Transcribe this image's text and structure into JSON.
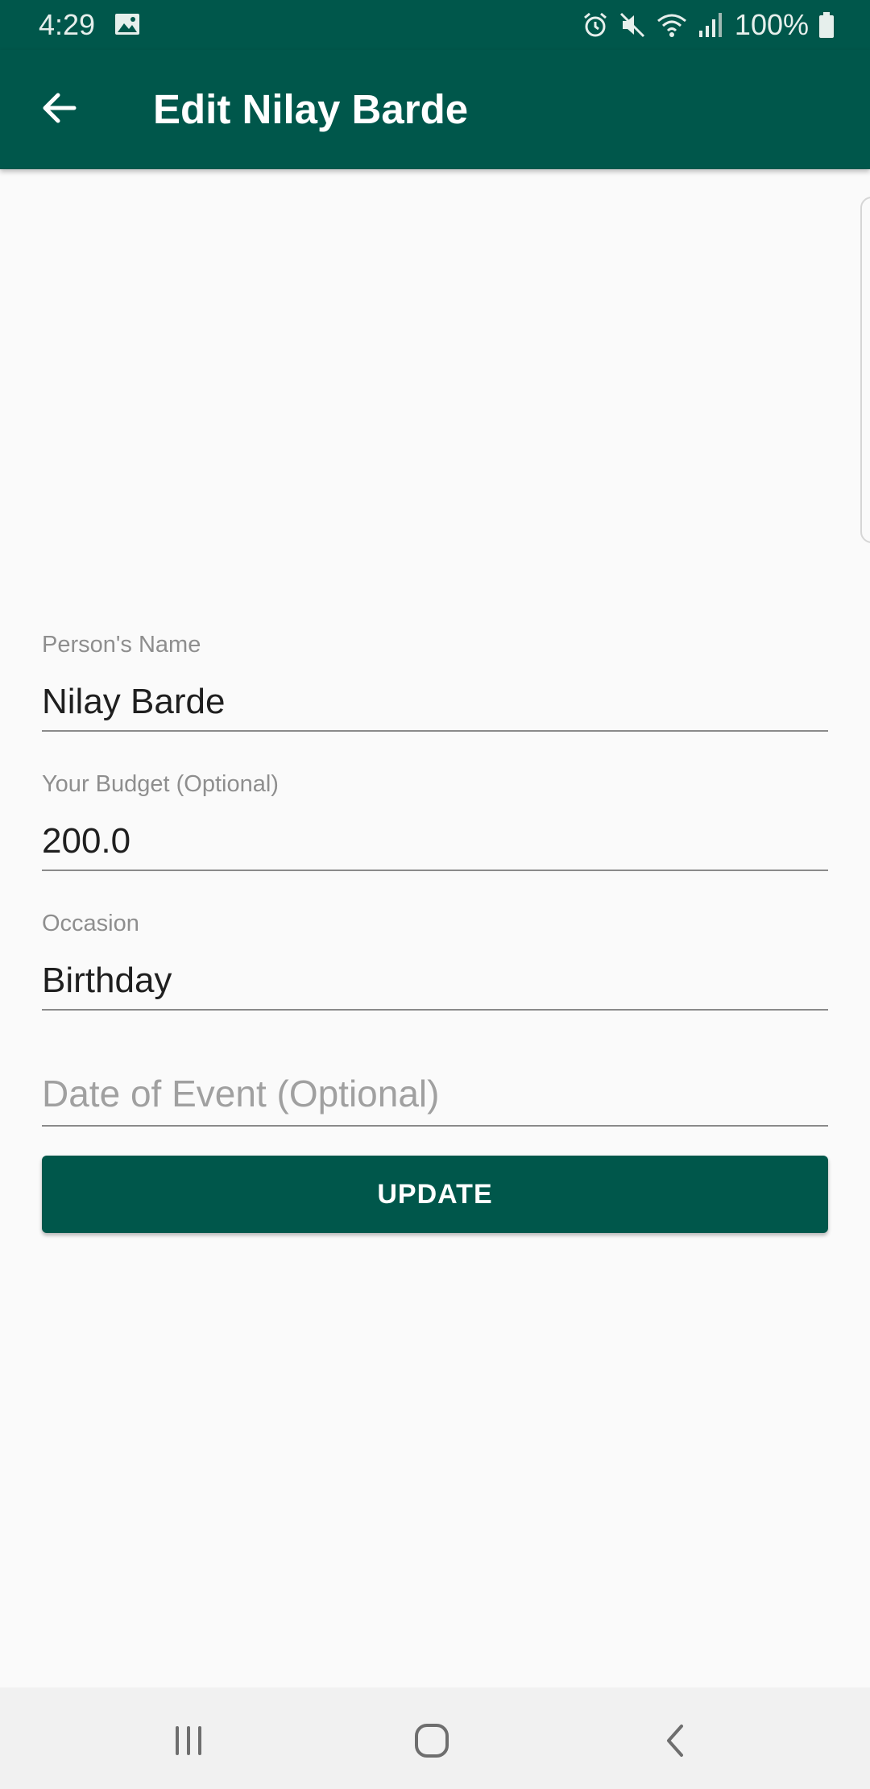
{
  "status_bar": {
    "time": "4:29",
    "battery": "100%",
    "icons": [
      "gallery-icon",
      "alarm-icon",
      "mute-icon",
      "wifi-icon",
      "signal-icon",
      "battery-icon"
    ]
  },
  "app_bar": {
    "title": "Edit Nilay Barde",
    "back_icon": "arrow-left-icon",
    "background_color": "#00574b"
  },
  "form": {
    "name": {
      "label": "Person's Name",
      "value": "Nilay Barde"
    },
    "budget": {
      "label": "Your Budget (Optional)",
      "value": "200.0"
    },
    "occasion": {
      "label": "Occasion",
      "value": "Birthday"
    },
    "date": {
      "placeholder": "Date of Event (Optional)",
      "value": ""
    },
    "update_label": "UPDATE"
  },
  "nav_bar": {
    "icons": [
      "recent-apps-icon",
      "home-icon",
      "back-icon"
    ]
  },
  "colors": {
    "primary": "#00574b",
    "background": "#fafafa",
    "label": "#8e8e8e",
    "text": "#1f1f1f"
  }
}
